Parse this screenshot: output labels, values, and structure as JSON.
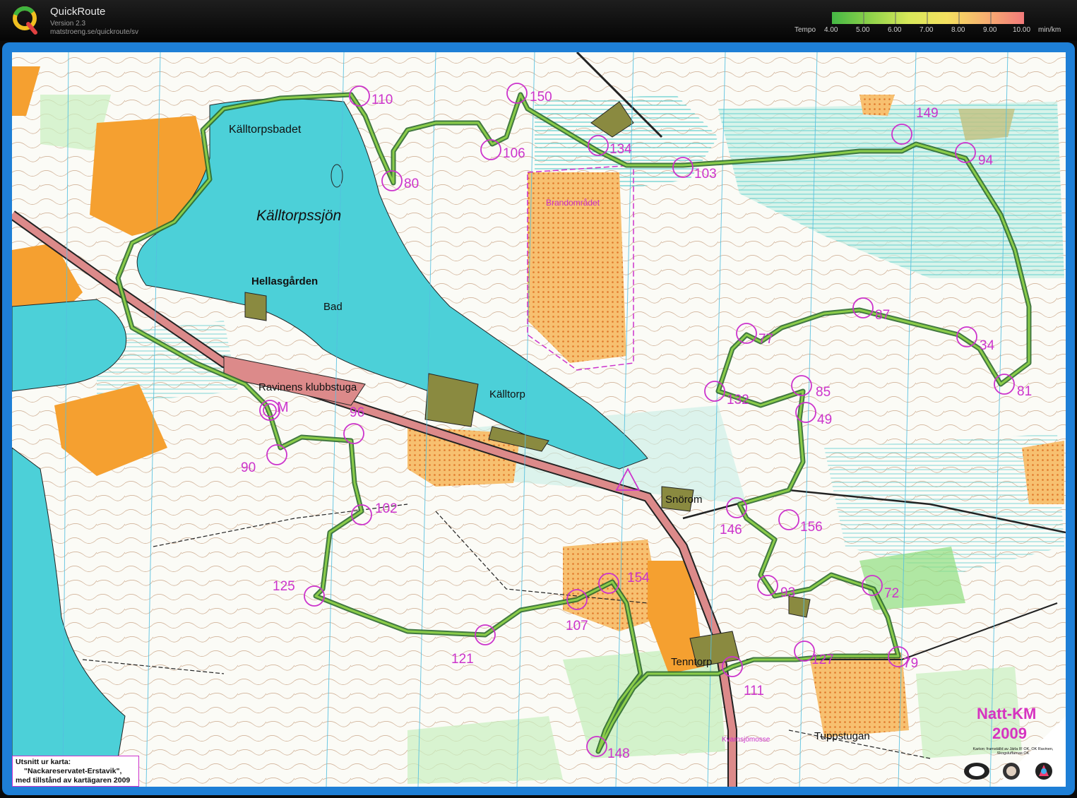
{
  "app": {
    "name": "QuickRoute",
    "version": "Version 2.3",
    "url": "matstroeng.se/quickroute/sv"
  },
  "tempo_scale": {
    "label": "Tempo",
    "ticks": [
      "4.00",
      "5.00",
      "6.00",
      "7.00",
      "8.00",
      "9.00",
      "10.00"
    ],
    "unit": "min/km",
    "colors": [
      "#45b845",
      "#8fd24a",
      "#d8e85a",
      "#f5e060",
      "#f7b070",
      "#f27a7a"
    ]
  },
  "map": {
    "lake_name": "Källtorpssjön",
    "places": [
      {
        "name": "Källtorpsbadet"
      },
      {
        "name": "Hellasgården"
      },
      {
        "name": "Bad"
      },
      {
        "name": "Ravinens klubbstuga"
      },
      {
        "name": "Källtorp"
      },
      {
        "name": "Brandområdet"
      },
      {
        "name": "Snörom"
      },
      {
        "name": "Tenntorp"
      },
      {
        "name": "Tuppstugan"
      },
      {
        "name": "Kvarnsjömosse"
      }
    ],
    "start_marker": "M",
    "controls": [
      "110",
      "150",
      "149",
      "134",
      "106",
      "103",
      "94",
      "80",
      "87",
      "77",
      "34",
      "81",
      "132",
      "85",
      "49",
      "96",
      "90",
      "102",
      "146",
      "156",
      "125",
      "154",
      "93",
      "72",
      "107",
      "121",
      "127",
      "79",
      "111",
      "148"
    ],
    "event_title": "Natt-KM",
    "event_year": "2009",
    "map_credit_small": "Karton: framställd av Järla IF OK, OK Ravinen, Skogsluffarnas OK",
    "credit_lines": [
      "Utsnitt ur karta:",
      "\"Nackareservatet-Erstavik\",",
      "med tillstånd av kartägaren 2009"
    ]
  }
}
